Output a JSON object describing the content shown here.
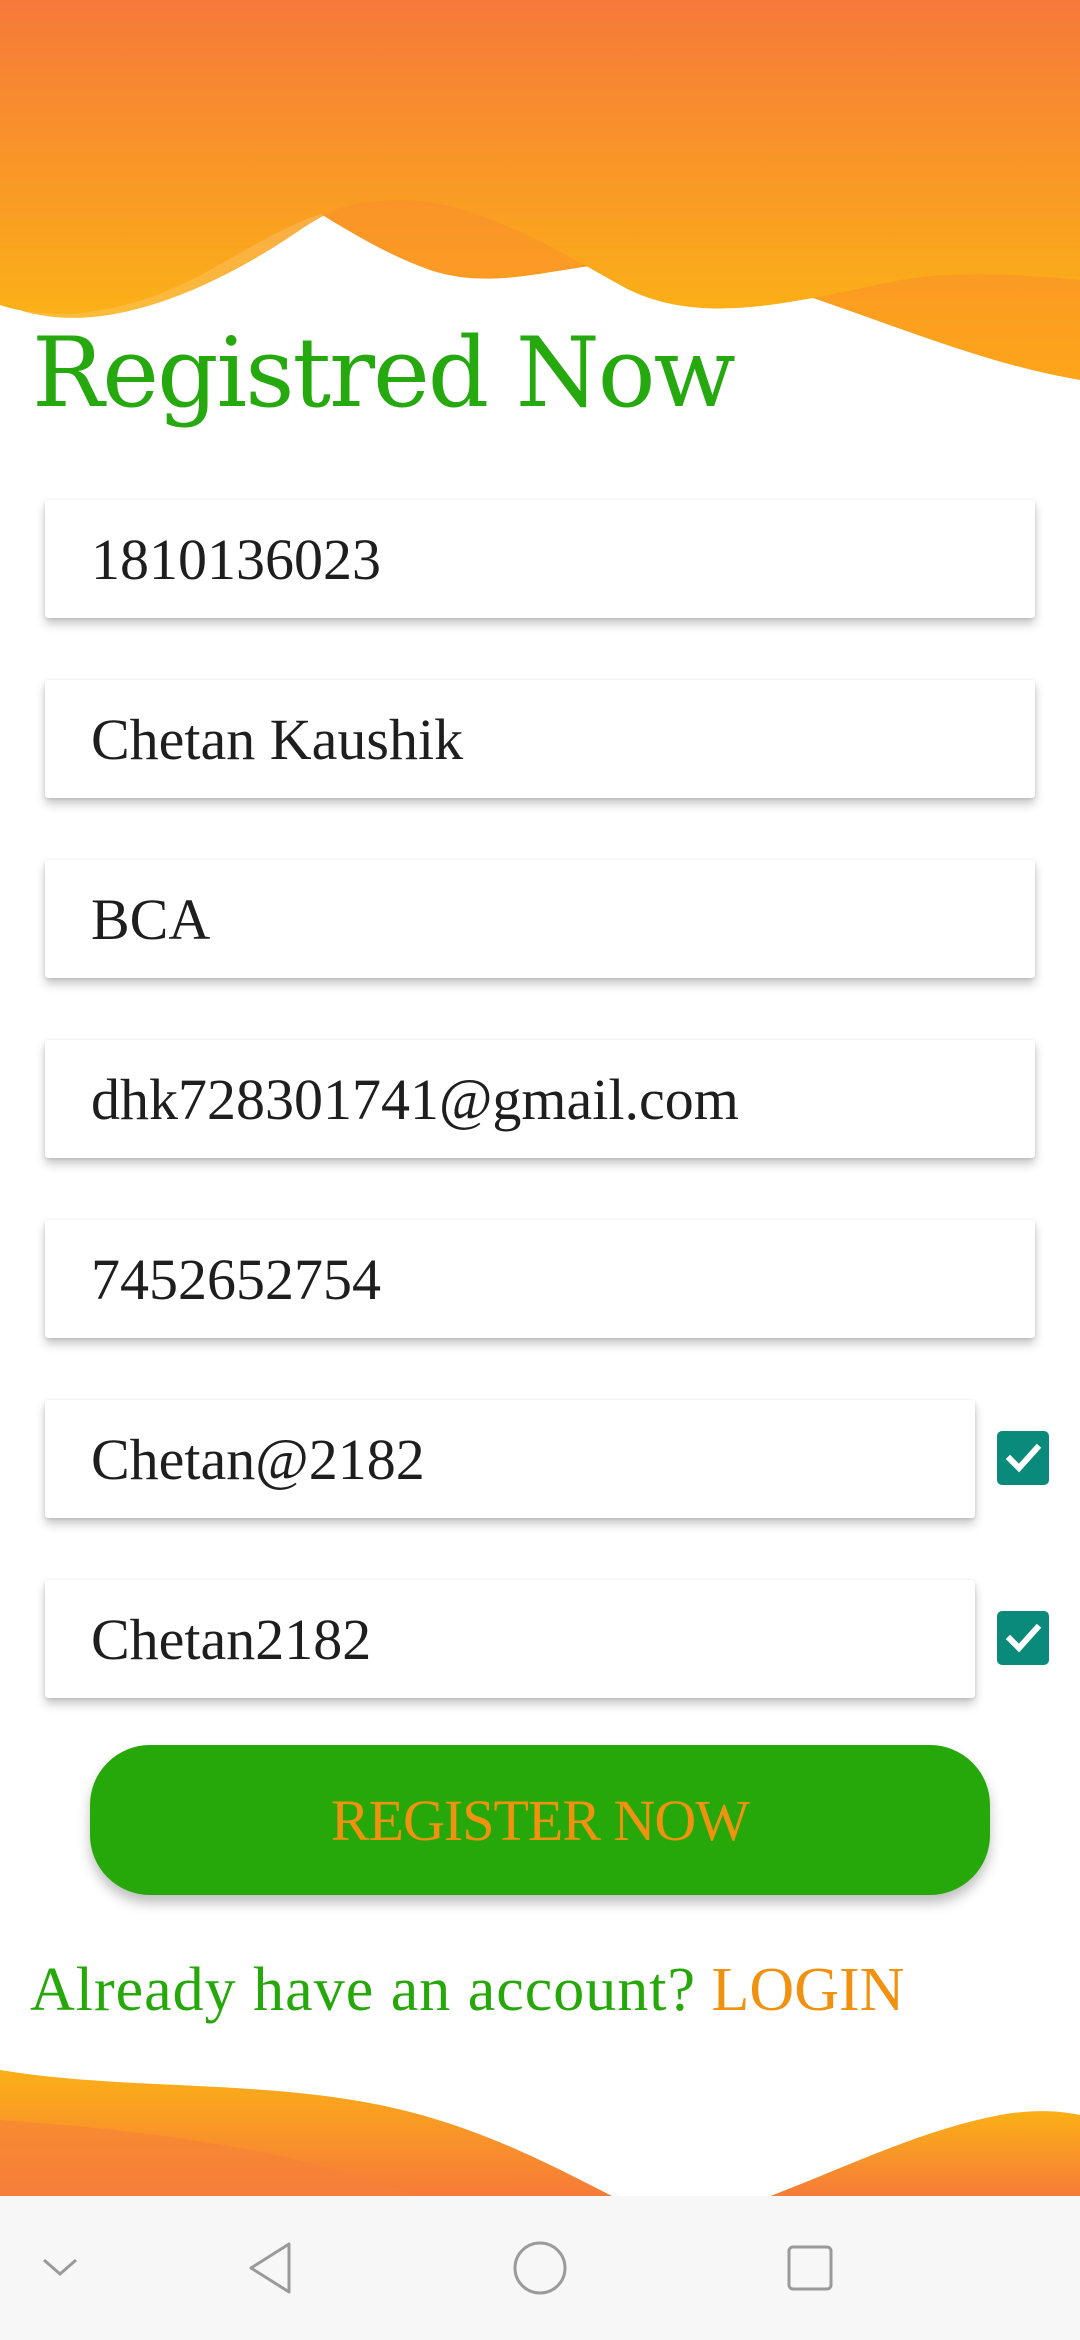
{
  "screen": {
    "title": "Registred Now",
    "accent_green": "#27a80a",
    "accent_orange": "#f0920f",
    "checkbox_color": "#0a8a7a"
  },
  "form": {
    "fields": [
      {
        "value": "1810136023"
      },
      {
        "value": "Chetan Kaushik"
      },
      {
        "value": "BCA"
      },
      {
        "value": "dhk728301741@gmail.com"
      },
      {
        "value": "7452652754"
      },
      {
        "value": "Chetan@2182",
        "checkbox_checked": true
      },
      {
        "value": "Chetan2182",
        "checkbox_checked": true
      }
    ],
    "register_label": "REGISTER NOW"
  },
  "footer": {
    "prompt": "Already have an account?",
    "login_label": "LOGIN"
  },
  "navbar": {
    "icons": [
      "chevron-down-icon",
      "back-icon",
      "home-icon",
      "recents-icon"
    ]
  }
}
